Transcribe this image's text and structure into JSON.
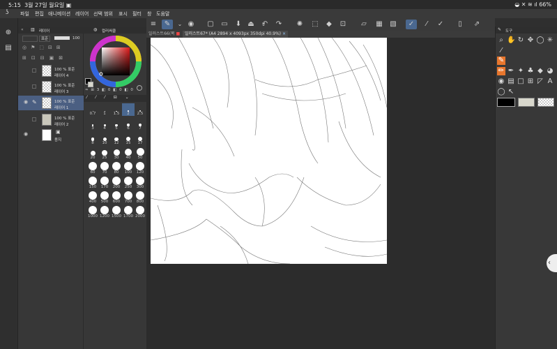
{
  "status": {
    "time": "5:15",
    "date": "3월 27일 월요일",
    "battery": "66%"
  },
  "menu": [
    "파일",
    "편집",
    "애니메이션",
    "레이어",
    "선택 범위",
    "표시",
    "필터",
    "창",
    "도움말"
  ],
  "layer_panel": {
    "title": "레이어",
    "blend_mode": "표준",
    "opacity": "100",
    "layers": [
      {
        "mode": "100 % 표준",
        "name": "레이어 4"
      },
      {
        "mode": "100 % 표준",
        "name": "레이어 3"
      },
      {
        "mode": "100 % 표준",
        "name": "레이어 1"
      },
      {
        "mode": "100 % 표준",
        "name": "레이어 2"
      },
      {
        "mode": "",
        "name": "용지"
      }
    ]
  },
  "color_panel": {
    "title": "컬러써클",
    "readout": [
      "3",
      "0",
      "0",
      "0"
    ]
  },
  "brush_sizes": [
    "0.7",
    "1",
    "1.5",
    "2",
    "2.5",
    "3",
    "4",
    "5",
    "6",
    "7",
    "8",
    "10",
    "12",
    "15",
    "17",
    "20",
    "25",
    "30",
    "40",
    "50",
    "60",
    "70",
    "80",
    "100",
    "120",
    "150",
    "170",
    "200",
    "250",
    "300",
    "400",
    "500",
    "600",
    "700",
    "800",
    "1000",
    "1200",
    "1500",
    "1700",
    "2000"
  ],
  "tabs": [
    {
      "label": "일러스트66(복"
    },
    {
      "label": "일러스트67* (A4 2894 x 4093px 350dpi 40.9%)"
    }
  ],
  "tool_panel": {
    "title": "도구"
  },
  "colors": {
    "main": "#000000",
    "sub": "#d8d7cc",
    "accent": "#4a6890"
  }
}
